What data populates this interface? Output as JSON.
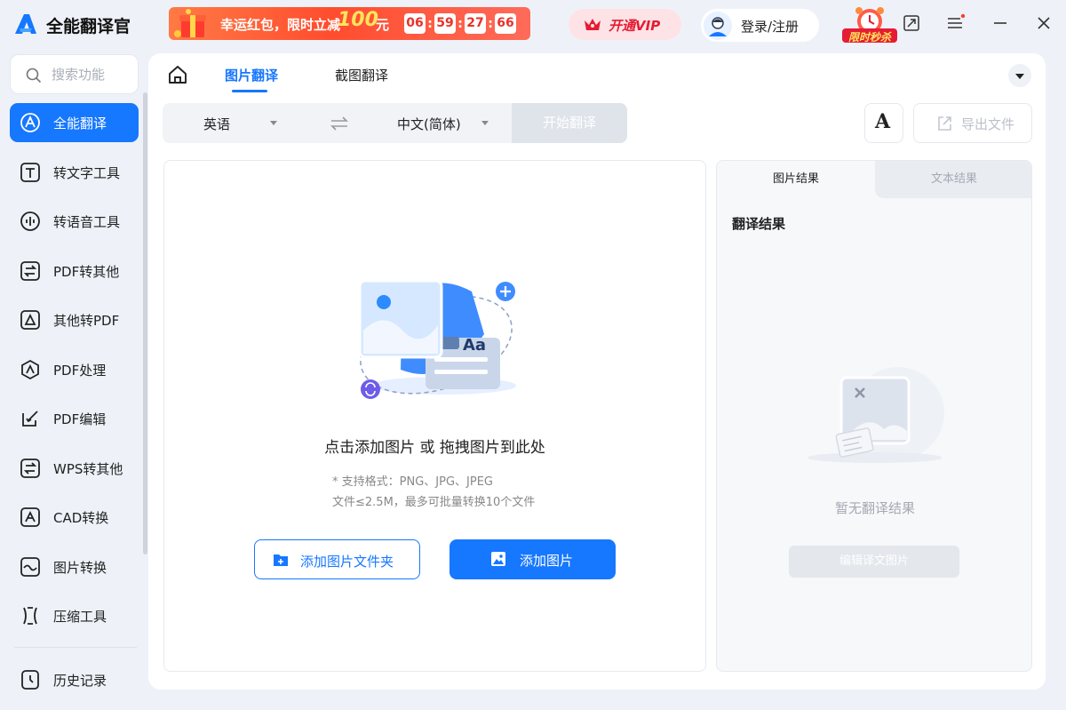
{
  "app": {
    "title": "全能翻译官"
  },
  "promo": {
    "text": "幸运红包，限时立减",
    "amount": "100",
    "unit": "元",
    "timer": [
      "06",
      "59",
      "27",
      "66"
    ]
  },
  "header": {
    "vip_label": "开通VIP",
    "login_label": "登录/注册",
    "flash_sale": "限时秒杀"
  },
  "sidebar": {
    "search_placeholder": "搜索功能",
    "items": [
      {
        "label": "全能翻译",
        "icon": "translate-icon",
        "active": true
      },
      {
        "label": "转文字工具",
        "icon": "text-tool-icon"
      },
      {
        "label": "转语音工具",
        "icon": "voice-tool-icon"
      },
      {
        "label": "PDF转其他",
        "icon": "pdf-convert-icon"
      },
      {
        "label": "其他转PDF",
        "icon": "to-pdf-icon"
      },
      {
        "label": "PDF处理",
        "icon": "pdf-process-icon"
      },
      {
        "label": "PDF编辑",
        "icon": "pdf-edit-icon"
      },
      {
        "label": "WPS转其他",
        "icon": "wps-convert-icon"
      },
      {
        "label": "CAD转换",
        "icon": "cad-icon"
      },
      {
        "label": "图片转换",
        "icon": "image-convert-icon"
      },
      {
        "label": "压缩工具",
        "icon": "compress-icon"
      }
    ],
    "history_label": "历史记录"
  },
  "tabs": {
    "image_translate": "图片翻译",
    "screenshot_translate": "截图翻译"
  },
  "toolbar": {
    "source_lang": "英语",
    "target_lang": "中文(简体)",
    "start_label": "开始翻译",
    "font_label": "A",
    "export_label": "导出文件"
  },
  "upload": {
    "title": "点击添加图片 或 拖拽图片到此处",
    "formats": "* 支持格式：PNG、JPG、JPEG",
    "limit": "文件≤2.5M，最多可批量转换10个文件",
    "add_folder": "添加图片文件夹",
    "add_image": "添加图片",
    "illus_text": "Aa"
  },
  "result": {
    "tab_image": "图片结果",
    "tab_text": "文本结果",
    "heading": "翻译结果",
    "empty": "暂无翻译结果",
    "edit_button": "编辑译文图片"
  },
  "colors": {
    "accent": "#1677ff",
    "vip": "#e51c34",
    "promo": "#ff4d2e"
  }
}
